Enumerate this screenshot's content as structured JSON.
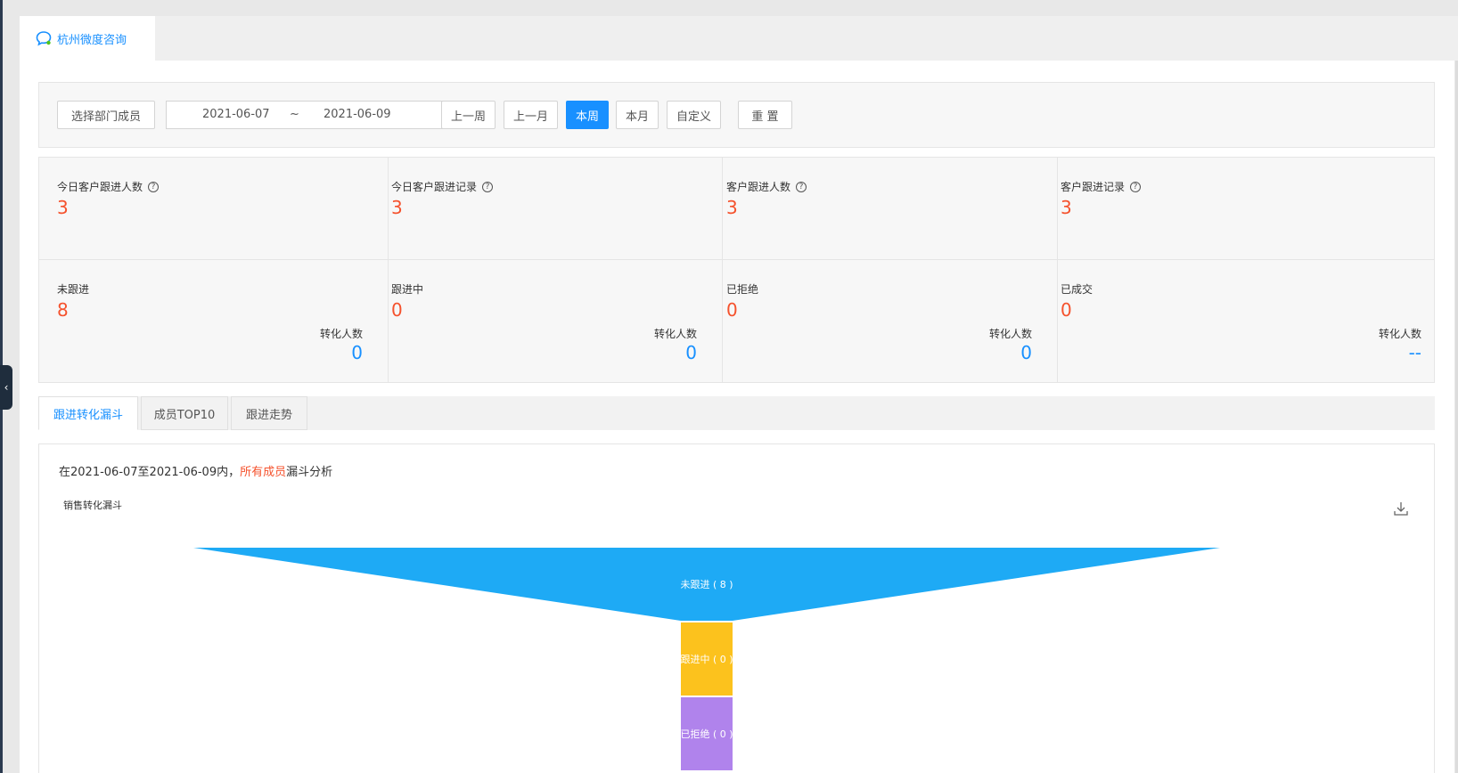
{
  "app": {
    "tab_label": "杭州微度咨询"
  },
  "filters": {
    "select_members": "选择部门成员",
    "start_date": "2021-06-07",
    "separator": "~",
    "end_date": "2021-06-09",
    "prev_week": "上一周",
    "prev_month": "上一月",
    "this_week": "本周",
    "this_month": "本月",
    "custom": "自定义",
    "reset": "重 置",
    "active": "本周"
  },
  "stats_top": [
    {
      "label": "今日客户跟进人数",
      "value": "3"
    },
    {
      "label": "今日客户跟进记录",
      "value": "3"
    },
    {
      "label": "客户跟进人数",
      "value": "3"
    },
    {
      "label": "客户跟进记录",
      "value": "3"
    }
  ],
  "stats_bottom": [
    {
      "label": "未跟进",
      "value": "8",
      "conv_label": "转化人数",
      "conv_value": "0"
    },
    {
      "label": "跟进中",
      "value": "0",
      "conv_label": "转化人数",
      "conv_value": "0"
    },
    {
      "label": "已拒绝",
      "value": "0",
      "conv_label": "转化人数",
      "conv_value": "0"
    },
    {
      "label": "已成交",
      "value": "0",
      "conv_label": "转化人数",
      "conv_value": "--"
    }
  ],
  "sub_tabs": [
    "跟进转化漏斗",
    "成员TOP10",
    "跟进走势"
  ],
  "panel": {
    "desc_prefix": "在2021-06-07至2021-06-09内，",
    "desc_highlight": "所有成员",
    "desc_suffix": "漏斗分析",
    "chart_title": "销售转化漏斗"
  },
  "chart_data": {
    "type": "funnel",
    "title": "销售转化漏斗",
    "stages": [
      {
        "name": "未跟进",
        "value": 8,
        "label": "未跟进 ( 8 )",
        "color": "#1eaaf5"
      },
      {
        "name": "跟进中",
        "value": 0,
        "label": "跟进中 ( 0 )",
        "color": "#fcc21d"
      },
      {
        "name": "已拒绝",
        "value": 0,
        "label": "已拒绝 ( 0 )",
        "color": "#b083ec"
      }
    ]
  },
  "colors": {
    "accent": "#1890ff",
    "highlight": "#f5522d"
  }
}
